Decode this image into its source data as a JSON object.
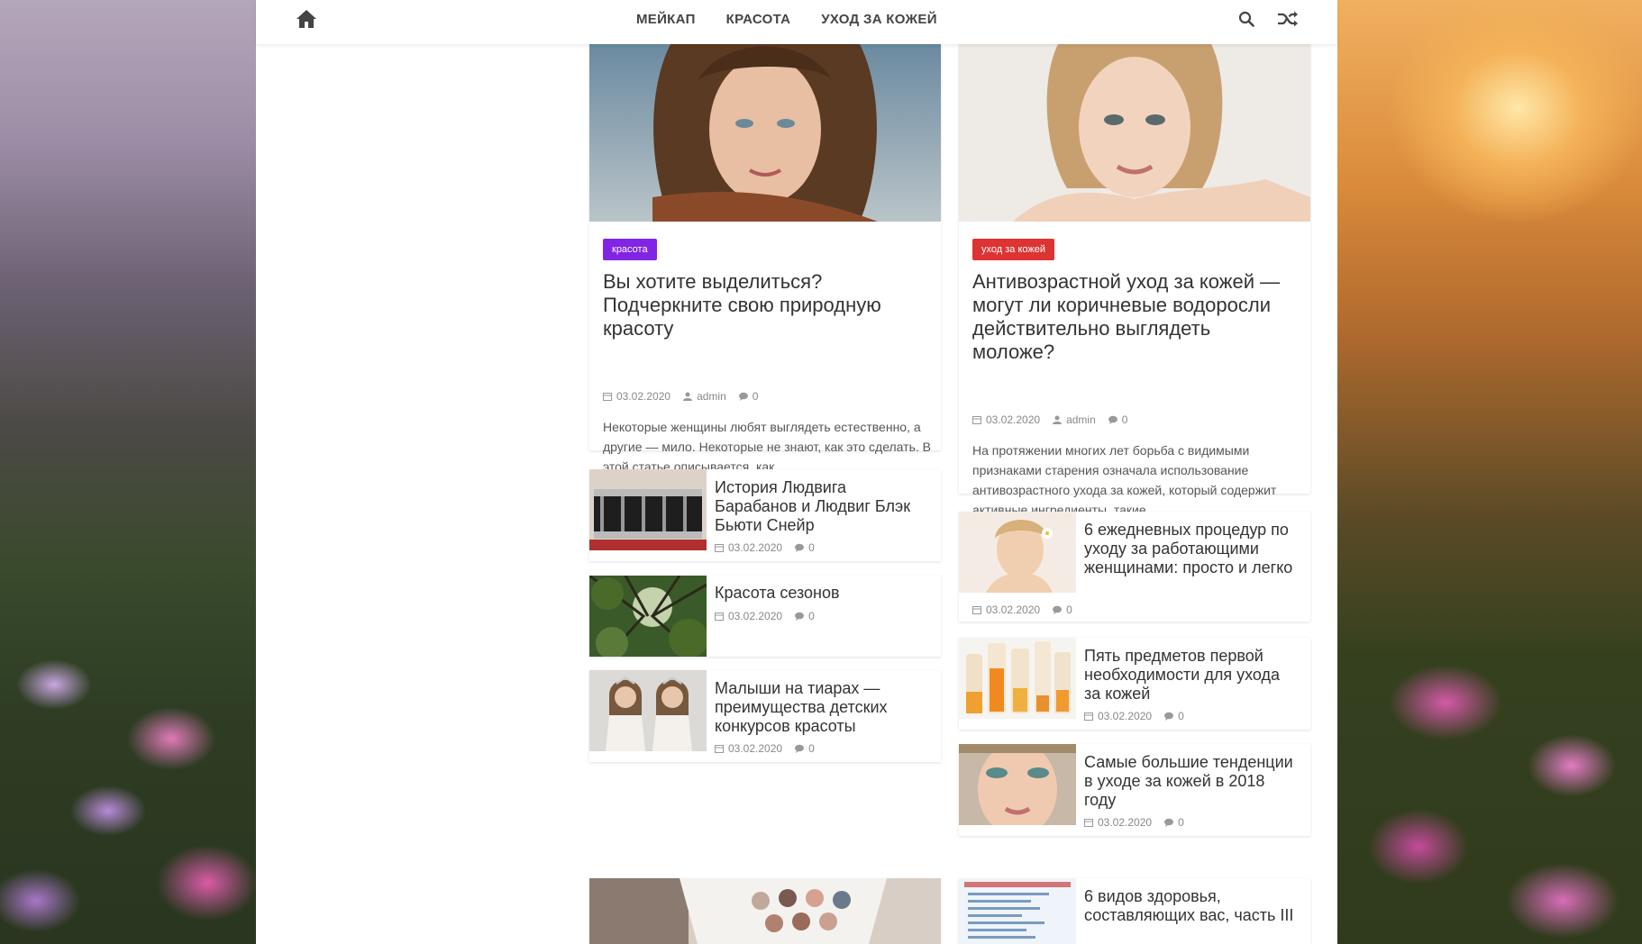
{
  "nav": {
    "items": [
      "МЕЙКАП",
      "КРАСОТА",
      "УХОД ЗА КОЖЕЙ"
    ]
  },
  "colors": {
    "badge_beauty": "#8224e3",
    "badge_skincare": "#dd3333"
  },
  "left_column": {
    "featured": {
      "badge": "красота",
      "title": "Вы хотите выделиться? Подчеркните свою природную красоту",
      "date": "03.02.2020",
      "author": "admin",
      "comments": "0",
      "excerpt": "Некоторые женщины любят выглядеть естественно, а другие — мило. Некоторые не знают, как это сделать. В этой статье описывается, как"
    },
    "posts": [
      {
        "title": "История Людвига Барабанов и Людвиг Блэк Бьюти Снейр",
        "date": "03.02.2020",
        "comments": "0"
      },
      {
        "title": "Красота сезонов",
        "date": "03.02.2020",
        "comments": "0"
      },
      {
        "title": "Малыши на тиарах — преимущества детских конкурсов красоты",
        "date": "03.02.2020",
        "comments": "0"
      }
    ]
  },
  "right_column": {
    "featured": {
      "badge": "уход за кожей",
      "title": "Антивозрастной уход за кожей — могут ли коричневые водоросли действительно выглядеть моложе?",
      "date": "03.02.2020",
      "author": "admin",
      "comments": "0",
      "excerpt": "На протяжении многих лет борьба с видимыми признаками старения означала использование антивозрастного ухода за кожей, который содержит активные ингредиенты, такие"
    },
    "posts": [
      {
        "title": "6 ежедневных процедур по уходу за работающими женщинами: просто и легко",
        "date": "03.02.2020",
        "comments": "0"
      },
      {
        "title": "Пять предметов первой необходимости для ухода за кожей",
        "date": "03.02.2020",
        "comments": "0"
      },
      {
        "title": "Самые большие тенденции в уходе за кожей в 2018 году",
        "date": "03.02.2020",
        "comments": "0"
      }
    ]
  },
  "bottom": {
    "right_post_title": "6 видов здоровья, составляющих вас, часть III"
  }
}
